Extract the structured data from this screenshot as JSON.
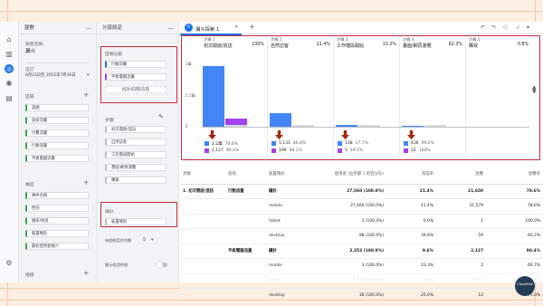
{
  "variables_panel": {
    "title": "變數",
    "exploration_name_label": "探索名稱：",
    "exploration_name": "漏斗",
    "date_label": "自訂",
    "date_range": "6月21日至 2022年7月30日",
    "segments_label": "區隔",
    "segments": [
      "美國",
      "直接流量",
      "付費流量",
      "行動流量",
      "平板電腦流量"
    ],
    "dimensions_label": "維度",
    "dimensions": [
      "事件名稱",
      "性別",
      "國家/地區",
      "裝置類別",
      "最初使用者媒介"
    ],
    "metrics_label": "指標"
  },
  "tab_settings_panel": {
    "title": "分頁設定",
    "segment_comparison_label": "區隔比較",
    "segment_comparisons": [
      "行動流量",
      "平板電腦流量"
    ],
    "drop_prompt": "拖放或選取區隔",
    "steps_label": "步驟",
    "steps": [
      "初次開啟/造訪",
      "自然訪客",
      "工作階段開始",
      "畫面/網頁瀏覽",
      "購買"
    ],
    "breakdown_label": "細分",
    "breakdown_value": "裝置類別",
    "rows_per_dim_label": "每個維度的列數",
    "rows_per_dim_value": "5",
    "show_elapsed_label": "顯示經過時間"
  },
  "toolbar": {
    "tab_name": "漏斗探索 1",
    "add_tab": "+"
  },
  "funnel_chart": {
    "y_ticks": [
      "3萬",
      "1.5萬",
      "0"
    ],
    "steps": [
      {
        "num": "步驟 1",
        "name": "初次開啟/造訪",
        "pct": "100%",
        "series": [
          {
            "value": "2.2萬",
            "pct": "78.6%"
          },
          {
            "value": "2,127",
            "pct": "90.4%"
          }
        ]
      },
      {
        "num": "步驟 2",
        "name": "自然訪客",
        "pct": "21.4%",
        "series": [
          {
            "value": "5,131",
            "pct": "86.8%"
          },
          {
            "value": "199",
            "pct": "88.1%"
          }
        ]
      },
      {
        "num": "步驟 3",
        "name": "工作階段開始",
        "pct": "13.2%",
        "series": [
          {
            "value": "138",
            "pct": "17.7%"
          },
          {
            "value": "5",
            "pct": "19.5%"
          }
        ]
      },
      {
        "num": "步驟 4",
        "name": "畫面/網頁瀏覽",
        "pct": "82.3%",
        "series": [
          {
            "value": "636",
            "pct": "99.2%"
          },
          {
            "value": "22",
            "pct": "100%"
          }
        ]
      },
      {
        "num": "步驟 5",
        "name": "購買",
        "pct": "0.8%",
        "series": []
      }
    ],
    "bar_fractions": [
      [
        0.96,
        0.13
      ],
      [
        0.21,
        0.03
      ],
      [
        0.03,
        0.01
      ],
      [
        0.02,
        0.005
      ],
      [
        0.0,
        0.0
      ]
    ]
  },
  "table": {
    "headers": [
      "步驟",
      "區隔",
      "裝置類別",
      "使用者 (佔步驟 1 的百分比)",
      "完成率",
      "放棄",
      "放棄率"
    ],
    "rows": [
      [
        "1. 初次開啟/造訪",
        "行動流量",
        "總計",
        "27,560 (100.0%)",
        "21.4%",
        "21,650",
        "78.6%"
      ],
      [
        "",
        "",
        "mobile",
        "27,460 (100.0%)",
        "21.4%",
        "21,579",
        "78.6%"
      ],
      [
        "",
        "",
        "tablet",
        "1 (100.0%)",
        "0.0%",
        "1",
        "100.0%"
      ],
      [
        "",
        "",
        "desktop",
        "98 (100.0%)",
        "39.8%",
        "59",
        "60.2%"
      ],
      [
        "",
        "平板電腦流量",
        "總計",
        "2,353 (100.0%)",
        "9.6%",
        "2,127",
        "90.4%"
      ],
      [
        "",
        "",
        "mobile",
        "3 (100.0%)",
        "33.3%",
        "2",
        "66.7%"
      ],
      [
        "",
        "",
        "tablet",
        "2,334 (100.0%)",
        "9.5%",
        "2,113",
        "90.5%"
      ],
      [
        "",
        "",
        "desktop",
        "16 (100.0%)",
        "25.0%",
        "12",
        "75.0%"
      ]
    ]
  },
  "logo_text": "CloudMile",
  "colors": {
    "accent": "#1a73e8",
    "highlight": "#c5293a",
    "series1": "#4285f4",
    "series2": "#a142f4"
  }
}
